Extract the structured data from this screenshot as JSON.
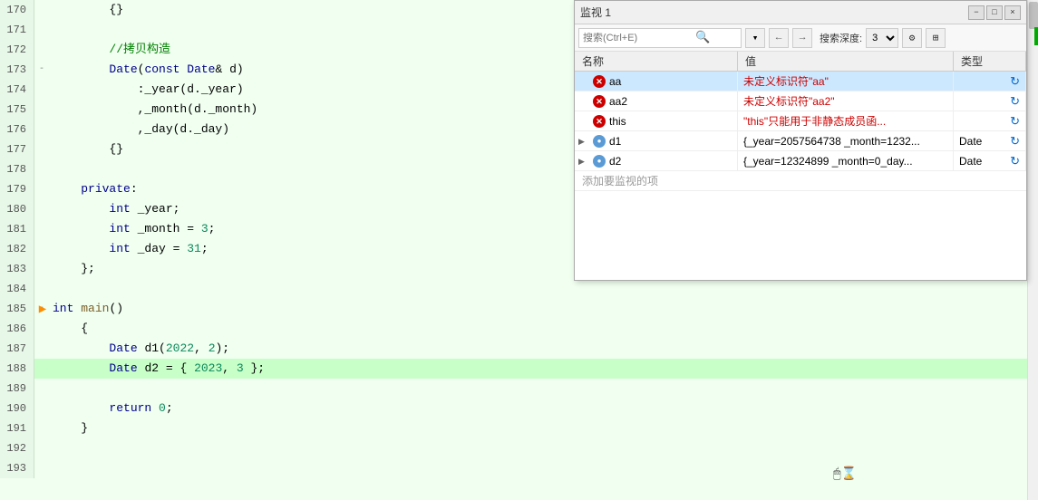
{
  "editor": {
    "lines": [
      {
        "num": 170,
        "fold": "",
        "indent": 2,
        "content": "{}",
        "highlight": false
      },
      {
        "num": 171,
        "fold": "",
        "indent": 0,
        "content": "",
        "highlight": false
      },
      {
        "num": 172,
        "fold": "",
        "indent": 2,
        "content": "//拷贝构造",
        "highlight": false
      },
      {
        "num": 173,
        "fold": "-",
        "indent": 2,
        "content": "Date(const Date& d)",
        "highlight": false
      },
      {
        "num": 174,
        "fold": "",
        "indent": 3,
        "content": ":_year(d._year)",
        "highlight": false
      },
      {
        "num": 175,
        "fold": "",
        "indent": 4,
        "content": ",_month(d._month)",
        "highlight": false
      },
      {
        "num": 176,
        "fold": "",
        "indent": 4,
        "content": ",_day(d._day)",
        "highlight": false
      },
      {
        "num": 177,
        "fold": "",
        "indent": 2,
        "content": "{}",
        "highlight": false
      },
      {
        "num": 178,
        "fold": "",
        "indent": 0,
        "content": "",
        "highlight": false
      },
      {
        "num": 179,
        "fold": "",
        "indent": 1,
        "content": "private:",
        "highlight": false
      },
      {
        "num": 180,
        "fold": "",
        "indent": 2,
        "content": "int _year;",
        "highlight": false,
        "keyword_int": true
      },
      {
        "num": 181,
        "fold": "",
        "indent": 2,
        "content": "int _month = 3;",
        "highlight": false,
        "keyword_int": true
      },
      {
        "num": 182,
        "fold": "",
        "indent": 2,
        "content": "int _day = 31;",
        "highlight": false,
        "keyword_int": true
      },
      {
        "num": 183,
        "fold": "",
        "indent": 1,
        "content": "};",
        "highlight": false
      },
      {
        "num": 184,
        "fold": "",
        "indent": 0,
        "content": "",
        "highlight": false
      },
      {
        "num": 185,
        "fold": "-",
        "indent": 0,
        "content": "int main()",
        "highlight": false,
        "is_main": true
      },
      {
        "num": 186,
        "fold": "",
        "indent": 1,
        "content": "{",
        "highlight": false
      },
      {
        "num": 187,
        "fold": "",
        "indent": 2,
        "content": "Date d1(2022, 2);",
        "highlight": false
      },
      {
        "num": 188,
        "fold": "",
        "indent": 2,
        "content": "Date d2 = { 2023, 3 };",
        "highlight": true
      },
      {
        "num": 189,
        "fold": "",
        "indent": 0,
        "content": "",
        "highlight": false
      },
      {
        "num": 190,
        "fold": "",
        "indent": 2,
        "content": "return 0;",
        "highlight": false
      },
      {
        "num": 191,
        "fold": "",
        "indent": 1,
        "content": "}",
        "highlight": false
      },
      {
        "num": 192,
        "fold": "",
        "indent": 0,
        "content": "",
        "highlight": false
      },
      {
        "num": 193,
        "fold": "",
        "indent": 0,
        "content": "",
        "highlight": false
      }
    ]
  },
  "watch_panel": {
    "title": "监视 1",
    "close_label": "×",
    "restore_label": "□",
    "float_label": "−",
    "search_placeholder": "搜索(Ctrl+E)",
    "depth_label": "搜索深度:",
    "depth_value": "3",
    "columns": [
      "名称",
      "值",
      "类型"
    ],
    "rows": [
      {
        "name": "aa",
        "value": "未定义标识符\"aa\"",
        "type": "",
        "status": "error",
        "selected": true
      },
      {
        "name": "aa2",
        "value": "未定义标识符\"aa2\"",
        "type": "",
        "status": "error",
        "selected": false
      },
      {
        "name": "this",
        "value": "\"this\"只能用于非静态成员函...",
        "type": "",
        "status": "error",
        "selected": false
      },
      {
        "name": "d1",
        "value": "{_year=2057564738 _month=1232...",
        "type": "Date",
        "status": "object",
        "selected": false,
        "expandable": true
      },
      {
        "name": "d2",
        "value": "{_year=12324899 _month=0_day...",
        "type": "Date",
        "status": "object",
        "selected": false,
        "expandable": true
      }
    ],
    "add_row_label": "添加要监视的项"
  }
}
